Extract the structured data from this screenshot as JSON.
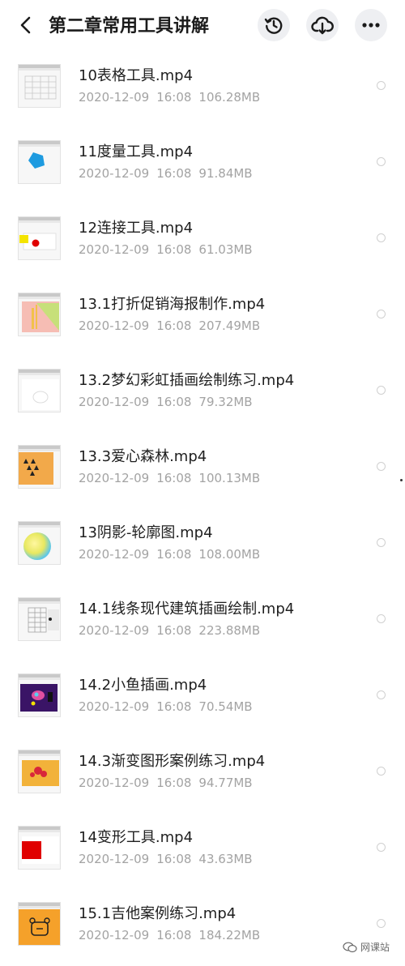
{
  "header": {
    "title": "第二章常用工具讲解",
    "icons": [
      "back-icon",
      "history-icon",
      "cloud-download-icon",
      "more-icon"
    ]
  },
  "files": [
    {
      "name": "10表格工具.mp4",
      "date": "2020-12-09",
      "time": "16:08",
      "size": "106.28MB"
    },
    {
      "name": "11度量工具.mp4",
      "date": "2020-12-09",
      "time": "16:08",
      "size": "91.84MB"
    },
    {
      "name": "12连接工具.mp4",
      "date": "2020-12-09",
      "time": "16:08",
      "size": "61.03MB"
    },
    {
      "name": "13.1打折促销海报制作.mp4",
      "date": "2020-12-09",
      "time": "16:08",
      "size": "207.49MB"
    },
    {
      "name": "13.2梦幻彩虹插画绘制练习.mp4",
      "date": "2020-12-09",
      "time": "16:08",
      "size": "79.32MB"
    },
    {
      "name": "13.3爱心森林.mp4",
      "date": "2020-12-09",
      "time": "16:08",
      "size": "100.13MB"
    },
    {
      "name": "13阴影-轮廓图.mp4",
      "date": "2020-12-09",
      "time": "16:08",
      "size": "108.00MB"
    },
    {
      "name": "14.1线条现代建筑插画绘制.mp4",
      "date": "2020-12-09",
      "time": "16:08",
      "size": "223.88MB"
    },
    {
      "name": "14.2小鱼插画.mp4",
      "date": "2020-12-09",
      "time": "16:08",
      "size": "70.54MB"
    },
    {
      "name": "14.3渐变图形案例练习.mp4",
      "date": "2020-12-09",
      "time": "16:08",
      "size": "94.77MB"
    },
    {
      "name": "14变形工具.mp4",
      "date": "2020-12-09",
      "time": "16:08",
      "size": "43.63MB"
    },
    {
      "name": "15.1吉他案例练习.mp4",
      "date": "2020-12-09",
      "time": "16:08",
      "size": "184.22MB"
    }
  ],
  "watermark": {
    "text": "网课站"
  },
  "colors": {
    "text": "#1f1f1f",
    "meta": "#a3a3a3",
    "button_bg": "#eeeff2"
  }
}
